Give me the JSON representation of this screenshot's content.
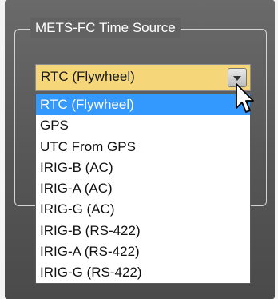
{
  "group": {
    "title": "METS-FC Time Source"
  },
  "combo": {
    "selected_value": "RTC (Flywheel)",
    "options": [
      "RTC (Flywheel)",
      "GPS",
      "UTC From GPS",
      "IRIG-B  (AC)",
      "IRIG-A  (AC)",
      "IRIG-G  (AC)",
      "IRIG-B  (RS-422)",
      "IRIG-A  (RS-422)",
      "IRIG-G  (RS-422)"
    ],
    "highlighted_index": 0
  },
  "colors": {
    "panel_bg": "#5a5a5a",
    "combo_bg": "#f5d779",
    "highlight": "#3399ff"
  }
}
